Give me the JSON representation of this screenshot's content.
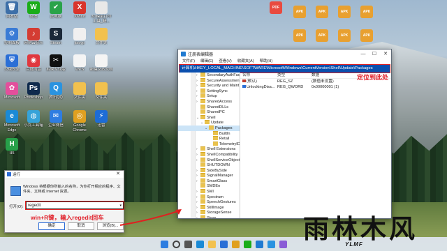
{
  "desktop_icons": [
    {
      "label": "回收站",
      "glyph": "🗑",
      "color": "#3d6fa8"
    },
    {
      "label": "微信",
      "glyph": "W",
      "color": "#1aad19"
    },
    {
      "label": "此电脑",
      "glyph": "✔",
      "color": "#2aa34a"
    },
    {
      "label": "XMind",
      "glyph": "X",
      "color": "#d9342b"
    },
    {
      "label": "3D模型打印工具_精...",
      "glyph": "",
      "color": "#e8e8e8"
    },
    {
      "label": "控制面板",
      "glyph": "⚙",
      "color": "#3a7bd5"
    },
    {
      "label": "网易云音乐",
      "glyph": "♪",
      "color": "#d43c33"
    },
    {
      "label": "Steam",
      "glyph": "S",
      "color": "#1b2838"
    },
    {
      "label": "jiaoyp",
      "glyph": "",
      "color": "#f0f0f0"
    },
    {
      "label": "文件夹",
      "glyph": "",
      "color": "#f2c14e"
    },
    {
      "label": "火绒安全",
      "glyph": "⛨",
      "color": "#2b6fd6"
    },
    {
      "label": "百度网盘",
      "glyph": "◉",
      "color": "#e0383e"
    },
    {
      "label": "剪映专业版",
      "glyph": "✂",
      "color": "#111111"
    },
    {
      "label": "WPS",
      "glyph": "",
      "color": "#f4f4f4"
    },
    {
      "label": "新建文本文档",
      "glyph": "",
      "color": "#f4f4f4"
    },
    {
      "label": "Microsoft",
      "glyph": "✿",
      "color": "#e34f9c"
    },
    {
      "label": "Photoshop",
      "glyph": "Ps",
      "color": "#0f2a4d"
    },
    {
      "label": "腾讯QQ",
      "glyph": "Q",
      "color": "#2a93e0"
    },
    {
      "label": "文件夹",
      "glyph": "",
      "color": "#f2c14e"
    },
    {
      "label": "文件夹",
      "glyph": "",
      "color": "#f2c14e"
    },
    {
      "label": "Microsoft Edge",
      "glyph": "e",
      "color": "#1a8ad6"
    },
    {
      "label": "小丸工具箱",
      "glyph": "◍",
      "color": "#36a3d9"
    },
    {
      "label": "企业微信",
      "glyph": "✉",
      "color": "#2f7de1"
    },
    {
      "label": "Google Chrome",
      "glyph": "◎",
      "color": "#e0a020"
    },
    {
      "label": "迅雷",
      "glyph": "⚡",
      "color": "#1d6cd6"
    },
    {
      "label": "H5",
      "glyph": "H",
      "color": "#27a04a"
    }
  ],
  "right_icons": [
    {
      "label": "PDF",
      "glyph": "PDF",
      "color": "#e94a3f"
    },
    {
      "label": "APK",
      "glyph": "APK",
      "color": "#e8a030"
    },
    {
      "label": "APK",
      "glyph": "APK",
      "color": "#e8a030"
    },
    {
      "label": "APK",
      "glyph": "APK",
      "color": "#e8a030"
    },
    {
      "label": "APK",
      "glyph": "APK",
      "color": "#e8a030"
    },
    {
      "label": "APK",
      "glyph": "APK",
      "color": "#e8a030"
    },
    {
      "label": "APK",
      "glyph": "APK",
      "color": "#e8a030"
    },
    {
      "label": "APK",
      "glyph": "APK",
      "color": "#e8a030"
    },
    {
      "label": "APK",
      "glyph": "APK",
      "color": "#e8a030"
    }
  ],
  "regedit": {
    "title": "注册表编辑器",
    "menu": [
      "文件(F)",
      "编辑(E)",
      "查看(V)",
      "收藏夹(A)",
      "帮助(H)"
    ],
    "address": "计算机\\HKEY_LOCAL_MACHINE\\SOFTWARE\\Microsoft\\Windows\\CurrentVersion\\Shell\\Update\\Packages",
    "tree": [
      {
        "label": "SecondaryAuthFac",
        "indent": 0,
        "arrow": "›"
      },
      {
        "label": "SecureAssessment",
        "indent": 0,
        "arrow": "›"
      },
      {
        "label": "Security and Maint",
        "indent": 0,
        "arrow": "›"
      },
      {
        "label": "SettingSync",
        "indent": 0,
        "arrow": "›"
      },
      {
        "label": "Setup",
        "indent": 0,
        "arrow": "›"
      },
      {
        "label": "SharedAccess",
        "indent": 0,
        "arrow": "›"
      },
      {
        "label": "SharedDLLs",
        "indent": 0,
        "arrow": ""
      },
      {
        "label": "SharedPC",
        "indent": 0,
        "arrow": ""
      },
      {
        "label": "Shell",
        "indent": 0,
        "arrow": "⌄"
      },
      {
        "label": "Update",
        "indent": 1,
        "arrow": "⌄"
      },
      {
        "label": "Packages",
        "indent": 2,
        "arrow": "⌄",
        "selected": true
      },
      {
        "label": "BuiltIn",
        "indent": 3,
        "arrow": ""
      },
      {
        "label": "Retail",
        "indent": 3,
        "arrow": ""
      },
      {
        "label": "TelemetryID",
        "indent": 3,
        "arrow": ""
      },
      {
        "label": "Shell Extensions",
        "indent": 0,
        "arrow": "›"
      },
      {
        "label": "ShellCompatibility",
        "indent": 0,
        "arrow": "›"
      },
      {
        "label": "ShellServiceObject",
        "indent": 0,
        "arrow": "›"
      },
      {
        "label": "SHUTDOWN",
        "indent": 0,
        "arrow": ""
      },
      {
        "label": "SideBySide",
        "indent": 0,
        "arrow": "›"
      },
      {
        "label": "SignalManager",
        "indent": 0,
        "arrow": "›"
      },
      {
        "label": "SmartGlass",
        "indent": 0,
        "arrow": "›"
      },
      {
        "label": "SMDEn",
        "indent": 0,
        "arrow": ""
      },
      {
        "label": "SMI",
        "indent": 0,
        "arrow": "›"
      },
      {
        "label": "Spectrum",
        "indent": 0,
        "arrow": "›"
      },
      {
        "label": "SpeechGestures",
        "indent": 0,
        "arrow": "›"
      },
      {
        "label": "StillImage",
        "indent": 0,
        "arrow": "›"
      },
      {
        "label": "StorageSense",
        "indent": 0,
        "arrow": "›"
      },
      {
        "label": "Store",
        "indent": 0,
        "arrow": "›"
      }
    ],
    "columns": [
      "名称",
      "类型",
      "数据"
    ],
    "values": [
      {
        "name": "(默认)",
        "type": "REG_SZ",
        "data": "(数值未设置)",
        "icon_color": "#c0392b"
      },
      {
        "name": "UnlockingDisa...",
        "type": "REG_QWORD",
        "data": "0x00000001 (1)",
        "icon_color": "#2a6fd6"
      }
    ]
  },
  "annotation_locate": "定位到此处",
  "run_dialog": {
    "title": "运行",
    "description": "Windows 将根据你所输入的名称，为你打开相应的程序、文件夹、文档或 Internet 资源。",
    "open_label": "打开(O):",
    "open_value": "regedit",
    "hint": "win+R键，输入regedit回车",
    "buttons": [
      "确定",
      "取消",
      "浏览(B)..."
    ]
  },
  "taskbar": {
    "icons": [
      {
        "name": "start-icon",
        "color": "#2d7de0"
      },
      {
        "name": "search-icon",
        "color": "#444444"
      },
      {
        "name": "taskview-icon",
        "color": "#555555"
      },
      {
        "name": "edge-icon",
        "color": "#1a8ad6"
      },
      {
        "name": "explorer-icon",
        "color": "#f2c14e"
      },
      {
        "name": "store-icon",
        "color": "#2a6fd6"
      },
      {
        "name": "chrome-icon",
        "color": "#e0a020"
      },
      {
        "name": "wechat-icon",
        "color": "#1aad19"
      },
      {
        "name": "regedit-icon",
        "color": "#1f7ad1"
      },
      {
        "name": "qq-icon",
        "color": "#2a93e0"
      },
      {
        "name": "app-icon",
        "color": "#8a5cd6"
      }
    ]
  },
  "watermark": {
    "main": "雨林木风",
    "sub": "YLMF"
  }
}
